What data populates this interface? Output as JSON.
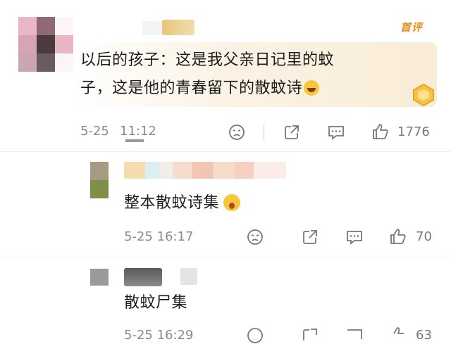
{
  "comments": [
    {
      "text": "以后的孩子：这是我父亲日记里的蚊子，这是他的青春留下的散蚊诗",
      "line1": "以后的孩子：这是我父亲日记里的蚊",
      "line2": "子，这是他的青春留下的散蚊诗",
      "emoji": "laughing-tears",
      "date": "5-25",
      "time": "11:12",
      "likes": "1776",
      "tag": "首评"
    }
  ],
  "replies": [
    {
      "text": "整本散蚊诗集",
      "emoji": "surprised-face",
      "timestamp": "5-25 16:17",
      "likes": "70"
    },
    {
      "text": "散蚊尸集",
      "timestamp": "5-25 16:29",
      "likes": "63"
    }
  ],
  "colors": {
    "accent": "#f08a1a",
    "meta": "#8a8a8a",
    "text": "#1c1c1c"
  },
  "icons": [
    "dislike-face-icon",
    "share-icon",
    "comment-icon",
    "thumbs-up-icon"
  ]
}
